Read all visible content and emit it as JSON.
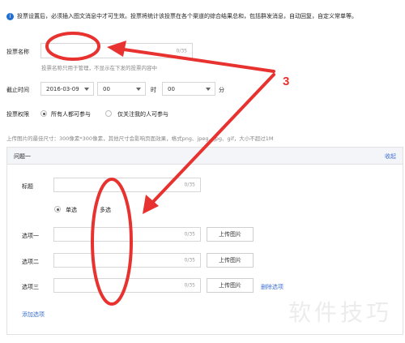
{
  "notice": {
    "icon": "info-icon",
    "text": "投票设置后，必须插入图文消息中才可生效。投票将统计该投票在各个渠道的综合结果总和，包括群发消息，自动回复，自定义常单等。"
  },
  "form": {
    "vote_name_label": "投票名称",
    "vote_name_value": "",
    "vote_name_counter": "0/35",
    "vote_name_hint": "投票名称只用于管理，不显示在下发的投票内容中",
    "deadline_label": "截止时间",
    "deadline_date": "2016-03-09",
    "deadline_hour": "00",
    "hour_unit": "时",
    "deadline_minute": "00",
    "minute_unit": "分",
    "permission_label": "投票权限",
    "permission_options": [
      "所有人都可参与",
      "仅关注我的人可参与"
    ],
    "permission_selected": 0,
    "upload_hint": "上传图片的最佳尺寸：300像素*300像素，其他尺寸会影响页面效果，格式png、jpeg、jpg、gif，大小不超过1M"
  },
  "question": {
    "title": "问题一",
    "collapse_label": "收起",
    "field_title_label": "标题",
    "field_title_counter": "0/35",
    "type_options": [
      "单选",
      "多选"
    ],
    "type_selected": 0,
    "options": [
      {
        "label": "选项一",
        "counter": "0/35",
        "upload": "上传图片"
      },
      {
        "label": "选项二",
        "counter": "0/35",
        "upload": "上传图片"
      },
      {
        "label": "选项三",
        "counter": "0/35",
        "upload": "上传图片",
        "delete": "删除选项"
      }
    ],
    "add_option_label": "添加选项"
  },
  "annotation": {
    "number_label": "3",
    "color": "#e8322f"
  },
  "watermark": "软件技巧"
}
